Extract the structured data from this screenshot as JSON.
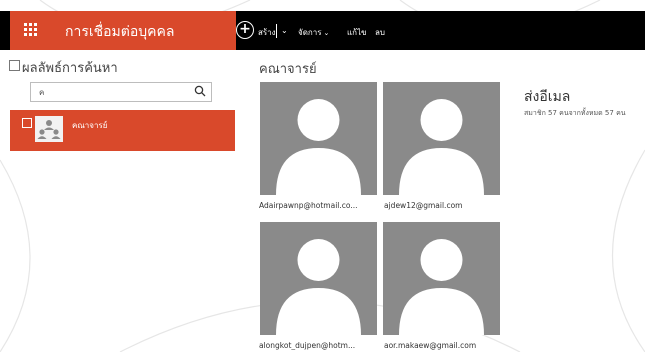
{
  "app": {
    "title": "การเชื่อมต่อบุคคล"
  },
  "toolbar": {
    "new_label": "สร้าง",
    "manage_label": "จัดการ",
    "edit_label": "แก้ไข",
    "delete_label": "ลบ"
  },
  "left": {
    "header": "ผลลัพธ์การค้นหา",
    "search_value": "ค",
    "group_label": "คณาจารย์"
  },
  "main": {
    "section_title": "คณาจารย์",
    "contacts": [
      {
        "email": "Adairpawnp@hotmail.co..."
      },
      {
        "email": "ajdew12@gmail.com"
      },
      {
        "email": "alongkot_dujpen@hotm..."
      },
      {
        "email": "aor.makaew@gmail.com"
      }
    ]
  },
  "side": {
    "send_mail": "ส่งอีเมล",
    "members": "สมาชิก 57 คนจากทั้งหมด 57 คน"
  },
  "colors": {
    "accent": "#d9492b",
    "topbar": "#000000",
    "photo_bg": "#8a8a8a"
  }
}
